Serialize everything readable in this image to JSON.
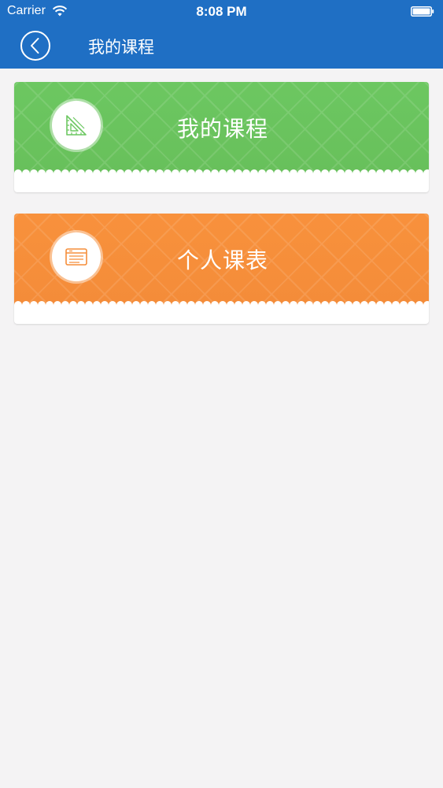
{
  "status_bar": {
    "carrier": "Carrier",
    "time": "8:08 PM",
    "wifi_icon": "wifi-icon",
    "battery_icon": "battery-icon"
  },
  "nav": {
    "title": "我的课程",
    "back_icon": "chevron-left-icon"
  },
  "cards": [
    {
      "title": "我的课程",
      "icon": "triangle-ruler-icon",
      "color": "#6cc761"
    },
    {
      "title": "个人课表",
      "icon": "schedule-icon",
      "color": "#f58e3a"
    }
  ],
  "colors": {
    "header": "#1f6fc4",
    "background": "#f4f3f4"
  }
}
